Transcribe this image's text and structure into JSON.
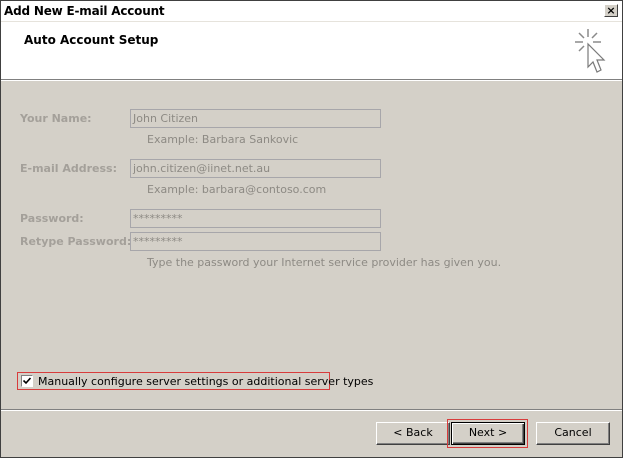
{
  "window": {
    "title": "Add New E-mail Account",
    "close_label": "×"
  },
  "header": {
    "title": "Auto Account Setup",
    "icon": "wizard-cursor-icon"
  },
  "form": {
    "name_label": "Your Name:",
    "name_value": "John Citizen",
    "name_example": "Example: Barbara Sankovic",
    "email_label": "E-mail Address:",
    "email_value": "john.citizen@iinet.net.au",
    "email_example": "Example: barbara@contoso.com",
    "password_label": "Password:",
    "password_value": "*********",
    "retype_label": "Retype Password:",
    "retype_value": "*********",
    "password_hint": "Type the password your Internet service provider has given you."
  },
  "manual_config": {
    "label": "Manually configure server settings or additional server types",
    "checked": true
  },
  "buttons": {
    "back": "< Back",
    "next": "Next >",
    "cancel": "Cancel"
  },
  "colors": {
    "highlight": "#d83c3c",
    "dialog_bg": "#d4d0c8",
    "disabled_text": "#a4a09a"
  }
}
